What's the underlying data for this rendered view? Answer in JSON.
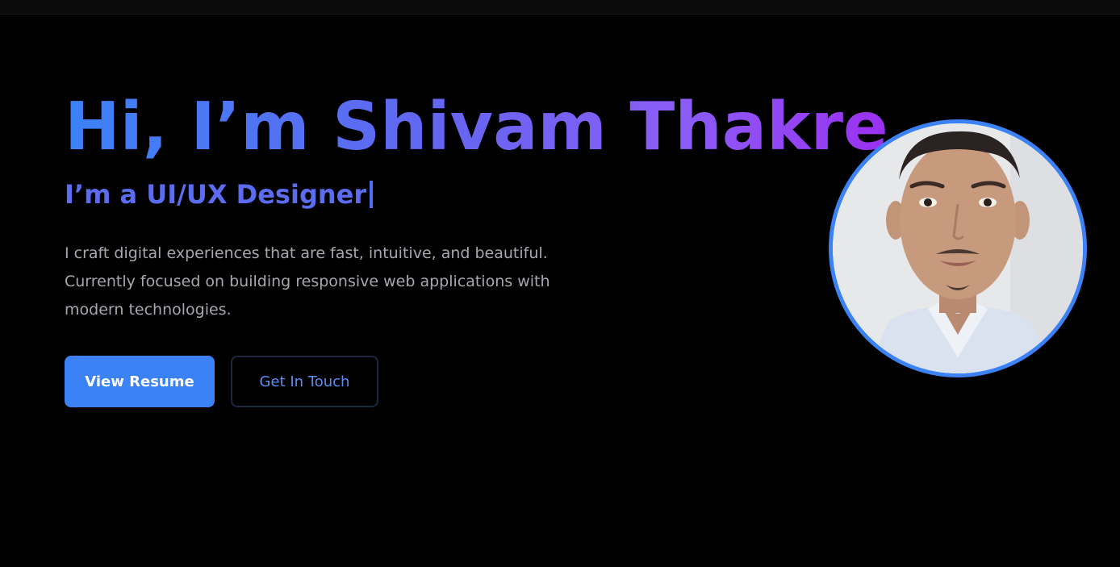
{
  "hero": {
    "title": "Hi, I’m Shivam Thakre",
    "subtitle": "I’m a UI/UX Designer",
    "description": "I craft digital experiences that are fast, intuitive, and beautiful. Currently focused on building responsive web applications with modern technologies.",
    "primary_button": "View Resume",
    "secondary_button": "Get In Touch"
  },
  "colors": {
    "background": "#000000",
    "accent_blue": "#3b82f6",
    "accent_purple": "#9b30f2",
    "subtitle": "#5b6cf0",
    "body_text": "#a7a7b0"
  },
  "avatar": {
    "icon": "profile-photo",
    "border_color": "#3b82f6"
  }
}
